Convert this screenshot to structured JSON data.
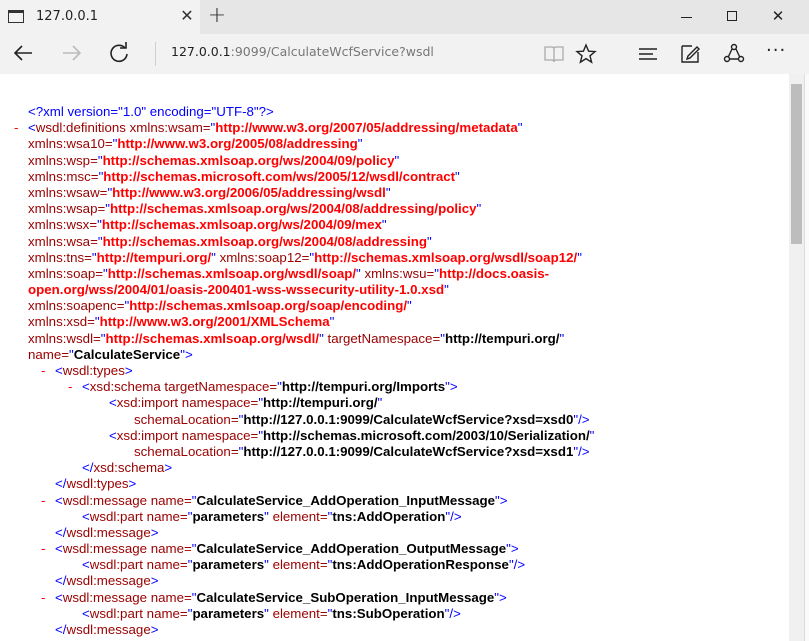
{
  "tab": {
    "title": "127.0.0.1"
  },
  "address": {
    "host": "127.0.0.1",
    "rest": ":9099/CalculateWcfService?wsdl"
  },
  "xml_lines": [
    {
      "indent": 28,
      "m": "",
      "parts": [
        [
          "b",
          "<?xml version=\"1.0\" encoding=\"UTF-8\"?>"
        ]
      ]
    },
    {
      "indent": 28,
      "m": "-",
      "parts": [
        [
          "b",
          "<"
        ],
        [
          "t",
          "wsdl:definitions "
        ],
        [
          "k",
          "xmlns:wsam="
        ],
        [
          "b",
          "\""
        ],
        [
          "v",
          "http://www.w3.org/2007/05/addressing/metadata"
        ],
        [
          "b",
          "\""
        ]
      ]
    },
    {
      "indent": 28,
      "m": "",
      "parts": [
        [
          "k",
          "xmlns:wsa10="
        ],
        [
          "b",
          "\""
        ],
        [
          "v",
          "http://www.w3.org/2005/08/addressing"
        ],
        [
          "b",
          "\""
        ]
      ]
    },
    {
      "indent": 28,
      "m": "",
      "parts": [
        [
          "k",
          "xmlns:wsp="
        ],
        [
          "b",
          "\""
        ],
        [
          "v",
          "http://schemas.xmlsoap.org/ws/2004/09/policy"
        ],
        [
          "b",
          "\""
        ]
      ]
    },
    {
      "indent": 28,
      "m": "",
      "parts": [
        [
          "k",
          "xmlns:msc="
        ],
        [
          "b",
          "\""
        ],
        [
          "v",
          "http://schemas.microsoft.com/ws/2005/12/wsdl/contract"
        ],
        [
          "b",
          "\""
        ]
      ]
    },
    {
      "indent": 28,
      "m": "",
      "parts": [
        [
          "k",
          "xmlns:wsaw="
        ],
        [
          "b",
          "\""
        ],
        [
          "v",
          "http://www.w3.org/2006/05/addressing/wsdl"
        ],
        [
          "b",
          "\""
        ]
      ]
    },
    {
      "indent": 28,
      "m": "",
      "parts": [
        [
          "k",
          "xmlns:wsap="
        ],
        [
          "b",
          "\""
        ],
        [
          "v",
          "http://schemas.xmlsoap.org/ws/2004/08/addressing/policy"
        ],
        [
          "b",
          "\""
        ]
      ]
    },
    {
      "indent": 28,
      "m": "",
      "parts": [
        [
          "k",
          "xmlns:wsx="
        ],
        [
          "b",
          "\""
        ],
        [
          "v",
          "http://schemas.xmlsoap.org/ws/2004/09/mex"
        ],
        [
          "b",
          "\""
        ]
      ]
    },
    {
      "indent": 28,
      "m": "",
      "parts": [
        [
          "k",
          "xmlns:wsa="
        ],
        [
          "b",
          "\""
        ],
        [
          "v",
          "http://schemas.xmlsoap.org/ws/2004/08/addressing"
        ],
        [
          "b",
          "\""
        ]
      ]
    },
    {
      "indent": 28,
      "m": "",
      "parts": [
        [
          "k",
          "xmlns:tns="
        ],
        [
          "b",
          "\""
        ],
        [
          "v",
          "http://tempuri.org/"
        ],
        [
          "b",
          "\" "
        ],
        [
          "k",
          "xmlns:soap12="
        ],
        [
          "b",
          "\""
        ],
        [
          "v",
          "http://schemas.xmlsoap.org/wsdl/soap12/"
        ],
        [
          "b",
          "\""
        ]
      ]
    },
    {
      "indent": 28,
      "m": "",
      "parts": [
        [
          "k",
          "xmlns:soap="
        ],
        [
          "b",
          "\""
        ],
        [
          "v",
          "http://schemas.xmlsoap.org/wsdl/soap/"
        ],
        [
          "b",
          "\" "
        ],
        [
          "k",
          "xmlns:wsu="
        ],
        [
          "b",
          "\""
        ],
        [
          "v",
          "http://docs.oasis-"
        ]
      ]
    },
    {
      "indent": 28,
      "m": "",
      "parts": [
        [
          "v",
          "open.org/wss/2004/01/oasis-200401-wss-wssecurity-utility-1.0.xsd"
        ],
        [
          "b",
          "\""
        ]
      ]
    },
    {
      "indent": 28,
      "m": "",
      "parts": [
        [
          "k",
          "xmlns:soapenc="
        ],
        [
          "b",
          "\""
        ],
        [
          "v",
          "http://schemas.xmlsoap.org/soap/encoding/"
        ],
        [
          "b",
          "\""
        ]
      ]
    },
    {
      "indent": 28,
      "m": "",
      "parts": [
        [
          "k",
          "xmlns:xsd="
        ],
        [
          "b",
          "\""
        ],
        [
          "v",
          "http://www.w3.org/2001/XMLSchema"
        ],
        [
          "b",
          "\""
        ]
      ]
    },
    {
      "indent": 28,
      "m": "",
      "parts": [
        [
          "k",
          "xmlns:wsdl="
        ],
        [
          "b",
          "\""
        ],
        [
          "v",
          "http://schemas.xmlsoap.org/wsdl/"
        ],
        [
          "b",
          "\" "
        ],
        [
          "k",
          "targetNamespace="
        ],
        [
          "b",
          "\""
        ],
        [
          "vb",
          "http://tempuri.org/"
        ],
        [
          "b",
          "\""
        ]
      ]
    },
    {
      "indent": 28,
      "m": "",
      "parts": [
        [
          "k",
          "name="
        ],
        [
          "b",
          "\""
        ],
        [
          "vb",
          "CalculateService"
        ],
        [
          "b",
          "\">"
        ]
      ]
    },
    {
      "indent": 55,
      "m": "-",
      "parts": [
        [
          "b",
          "<"
        ],
        [
          "t",
          "wsdl:types"
        ],
        [
          "b",
          ">"
        ]
      ]
    },
    {
      "indent": 82,
      "m": "-",
      "parts": [
        [
          "b",
          "<"
        ],
        [
          "t",
          "xsd:schema "
        ],
        [
          "k",
          "targetNamespace="
        ],
        [
          "b",
          "\""
        ],
        [
          "vb",
          "http://tempuri.org/Imports"
        ],
        [
          "b",
          "\">"
        ]
      ]
    },
    {
      "indent": 109,
      "m": "",
      "parts": [
        [
          "b",
          "<"
        ],
        [
          "t",
          "xsd:import "
        ],
        [
          "k",
          "namespace="
        ],
        [
          "b",
          "\""
        ],
        [
          "vb",
          "http://tempuri.org/"
        ],
        [
          "b",
          "\""
        ]
      ]
    },
    {
      "indent": 134,
      "m": "",
      "parts": [
        [
          "k",
          "schemaLocation="
        ],
        [
          "b",
          "\""
        ],
        [
          "vb",
          "http://127.0.0.1:9099/CalculateWcfService?xsd=xsd0"
        ],
        [
          "b",
          "\"/>"
        ]
      ]
    },
    {
      "indent": 109,
      "m": "",
      "parts": [
        [
          "b",
          "<"
        ],
        [
          "t",
          "xsd:import "
        ],
        [
          "k",
          "namespace="
        ],
        [
          "b",
          "\""
        ],
        [
          "vb",
          "http://schemas.microsoft.com/2003/10/Serialization/"
        ],
        [
          "b",
          "\""
        ]
      ]
    },
    {
      "indent": 134,
      "m": "",
      "parts": [
        [
          "k",
          "schemaLocation="
        ],
        [
          "b",
          "\""
        ],
        [
          "vb",
          "http://127.0.0.1:9099/CalculateWcfService?xsd=xsd1"
        ],
        [
          "b",
          "\"/>"
        ]
      ]
    },
    {
      "indent": 82,
      "m": "",
      "parts": [
        [
          "b",
          "</"
        ],
        [
          "t",
          "xsd:schema"
        ],
        [
          "b",
          ">"
        ]
      ]
    },
    {
      "indent": 55,
      "m": "",
      "parts": [
        [
          "b",
          "</"
        ],
        [
          "t",
          "wsdl:types"
        ],
        [
          "b",
          ">"
        ]
      ]
    },
    {
      "indent": 55,
      "m": "-",
      "parts": [
        [
          "b",
          "<"
        ],
        [
          "t",
          "wsdl:message "
        ],
        [
          "k",
          "name="
        ],
        [
          "b",
          "\""
        ],
        [
          "vb",
          "CalculateService_AddOperation_InputMessage"
        ],
        [
          "b",
          "\">"
        ]
      ]
    },
    {
      "indent": 82,
      "m": "",
      "parts": [
        [
          "b",
          "<"
        ],
        [
          "t",
          "wsdl:part "
        ],
        [
          "k",
          "name="
        ],
        [
          "b",
          "\""
        ],
        [
          "vb",
          "parameters"
        ],
        [
          "b",
          "\" "
        ],
        [
          "k",
          "element="
        ],
        [
          "b",
          "\""
        ],
        [
          "vb",
          "tns:AddOperation"
        ],
        [
          "b",
          "\"/>"
        ]
      ]
    },
    {
      "indent": 55,
      "m": "",
      "parts": [
        [
          "b",
          "</"
        ],
        [
          "t",
          "wsdl:message"
        ],
        [
          "b",
          ">"
        ]
      ]
    },
    {
      "indent": 55,
      "m": "-",
      "parts": [
        [
          "b",
          "<"
        ],
        [
          "t",
          "wsdl:message "
        ],
        [
          "k",
          "name="
        ],
        [
          "b",
          "\""
        ],
        [
          "vb",
          "CalculateService_AddOperation_OutputMessage"
        ],
        [
          "b",
          "\">"
        ]
      ]
    },
    {
      "indent": 82,
      "m": "",
      "parts": [
        [
          "b",
          "<"
        ],
        [
          "t",
          "wsdl:part "
        ],
        [
          "k",
          "name="
        ],
        [
          "b",
          "\""
        ],
        [
          "vb",
          "parameters"
        ],
        [
          "b",
          "\" "
        ],
        [
          "k",
          "element="
        ],
        [
          "b",
          "\""
        ],
        [
          "vb",
          "tns:AddOperationResponse"
        ],
        [
          "b",
          "\"/>"
        ]
      ]
    },
    {
      "indent": 55,
      "m": "",
      "parts": [
        [
          "b",
          "</"
        ],
        [
          "t",
          "wsdl:message"
        ],
        [
          "b",
          ">"
        ]
      ]
    },
    {
      "indent": 55,
      "m": "-",
      "parts": [
        [
          "b",
          "<"
        ],
        [
          "t",
          "wsdl:message "
        ],
        [
          "k",
          "name="
        ],
        [
          "b",
          "\""
        ],
        [
          "vb",
          "CalculateService_SubOperation_InputMessage"
        ],
        [
          "b",
          "\">"
        ]
      ]
    },
    {
      "indent": 82,
      "m": "",
      "parts": [
        [
          "b",
          "<"
        ],
        [
          "t",
          "wsdl:part "
        ],
        [
          "k",
          "name="
        ],
        [
          "b",
          "\""
        ],
        [
          "vb",
          "parameters"
        ],
        [
          "b",
          "\" "
        ],
        [
          "k",
          "element="
        ],
        [
          "b",
          "\""
        ],
        [
          "vb",
          "tns:SubOperation"
        ],
        [
          "b",
          "\"/>"
        ]
      ]
    },
    {
      "indent": 55,
      "m": "",
      "parts": [
        [
          "b",
          "</"
        ],
        [
          "t",
          "wsdl:message"
        ],
        [
          "b",
          ">"
        ]
      ]
    }
  ]
}
